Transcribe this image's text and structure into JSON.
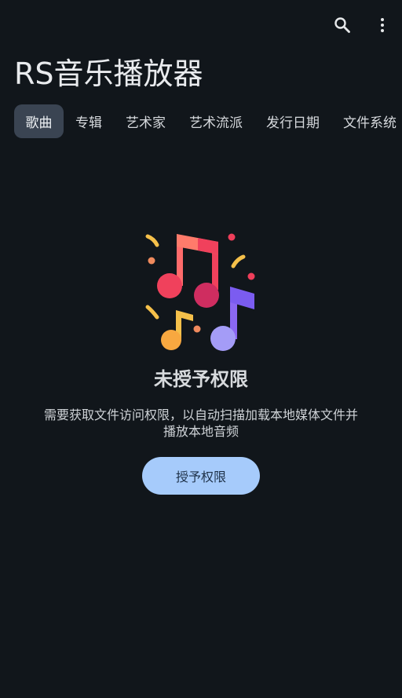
{
  "app": {
    "title": "RS音乐播放器"
  },
  "toolbar": {
    "search_icon": "search-icon",
    "more_icon": "more-vertical-icon"
  },
  "tabs": [
    {
      "label": "歌曲",
      "active": true
    },
    {
      "label": "专辑",
      "active": false
    },
    {
      "label": "艺术家",
      "active": false
    },
    {
      "label": "艺术流派",
      "active": false
    },
    {
      "label": "发行日期",
      "active": false
    },
    {
      "label": "文件系统",
      "active": false
    }
  ],
  "empty_state": {
    "illustration_icon": "music-notes-icon",
    "title": "未授予权限",
    "description": "需要获取文件访问权限，以自动扫描加载本地媒体文件并播放本地音频",
    "button_label": "授予权限"
  },
  "colors": {
    "background": "#11161b",
    "active_tab": "#3a4452",
    "button": "#a6cbfb",
    "button_text": "#1e3148"
  }
}
